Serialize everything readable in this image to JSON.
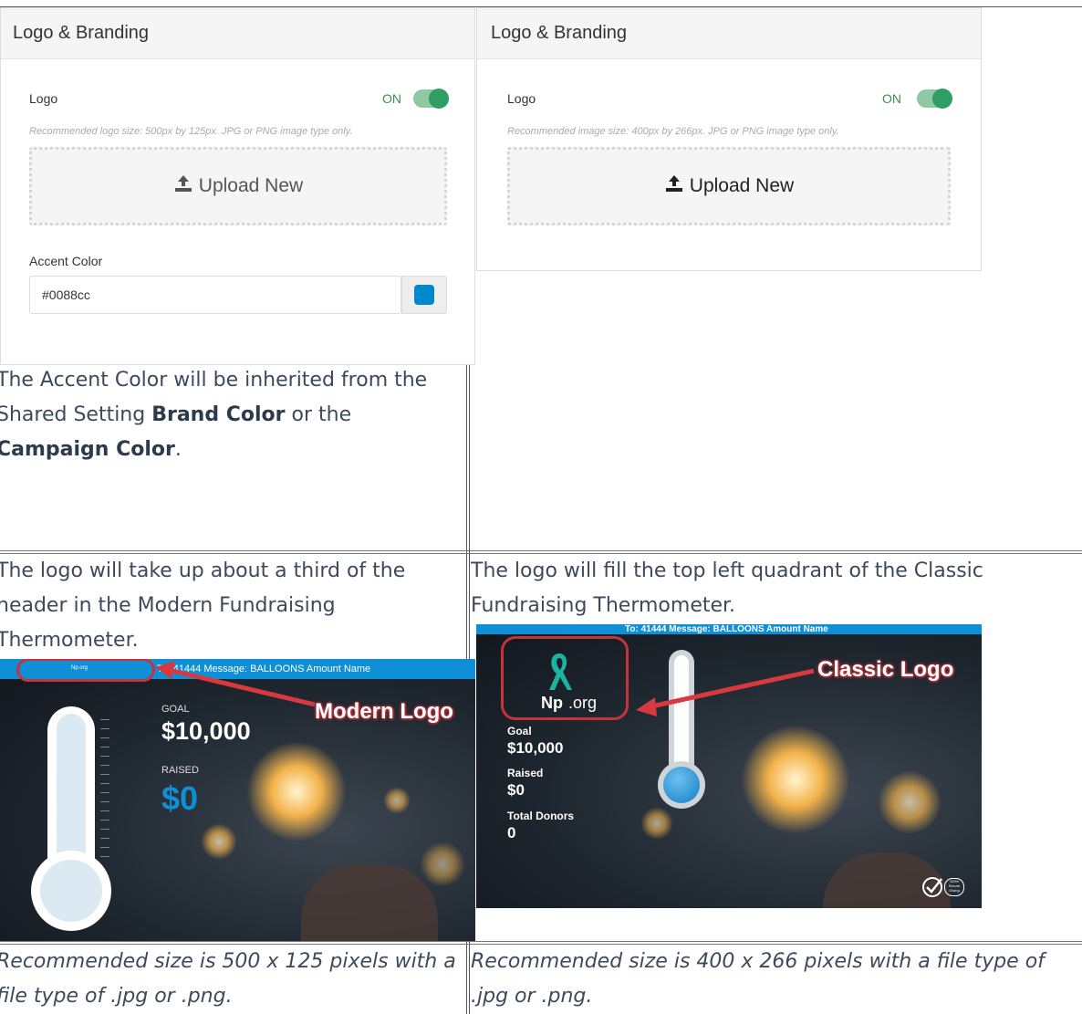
{
  "panels": [
    {
      "title": "Logo & Branding",
      "logo_label": "Logo",
      "toggle_state": "ON",
      "hint": "Recommended logo size: 500px by 125px. JPG or PNG image type only.",
      "upload_label": "Upload New",
      "accent_label": "Accent Color",
      "accent_value": "#0088cc",
      "accent_color": "#0088cc"
    },
    {
      "title": "Logo & Branding",
      "logo_label": "Logo",
      "toggle_state": "ON",
      "hint": "Recommended image size: 400px by 266px. JPG or PNG image type only.",
      "upload_label": "Upload New"
    }
  ],
  "notes": {
    "accent_pre": "The Accent Color will be inherited from the Shared Setting ",
    "accent_bold1": "Brand Color",
    "accent_mid": " or the ",
    "accent_bold2": "Campaign Color",
    "accent_end": ".",
    "modern_desc": "The logo will take up about a third of the header in the Modern Fundraising Thermometer.",
    "classic_desc": "The logo will fill the top left quadrant of the Classic Fundraising Thermometer.",
    "modern_size": "Recommended size is 500 x 125 pixels with a file type of .jpg or .png.",
    "classic_size": "Recommended size is 400 x 266 pixels with a file type of .jpg or .png."
  },
  "modern": {
    "header_text": "To: 41444 Message: BALLOONS Amount Name",
    "goal_label": "GOAL",
    "goal_value": "$10,000",
    "raised_label": "RAISED",
    "raised_value": "$0",
    "callout_label": "Modern Logo",
    "mini_logo": "Np.org",
    "level": 0
  },
  "classic": {
    "header_text": "To: 41444 Message: BALLOONS Amount Name",
    "logo_np": "Np",
    "logo_org": ".org",
    "goal_label": "Goal",
    "goal_value": "$10,000",
    "raised_label": "Raised",
    "raised_value": "$0",
    "donors_label": "Total Donors",
    "donors_value": "0",
    "callout_label": "Classic Logo",
    "secure_line1": "100%",
    "secure_line2": "Secure",
    "secure_line3": "Giving",
    "level": 0
  }
}
